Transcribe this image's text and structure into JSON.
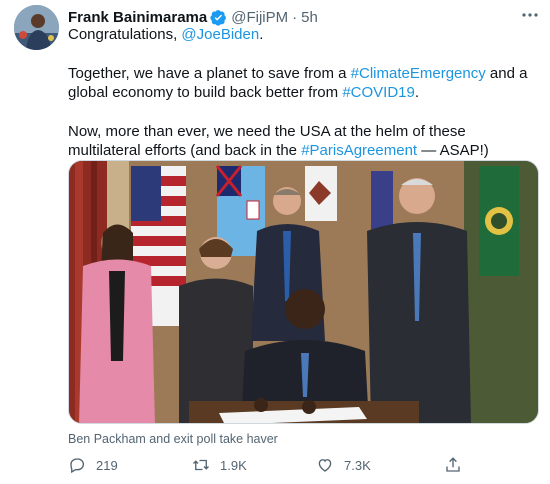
{
  "tweet": {
    "author": {
      "name": "Frank Bainimarama",
      "handle": "@FijiPM",
      "time": "5h"
    },
    "line1_prefix": "Congratulations, ",
    "line1_mention": "@JoeBiden",
    "line1_suffix": ".",
    "p2_a": "Together, we have a planet to save from a ",
    "p2_tag1": "#ClimateEmergency",
    "p2_b": " and a global economy to build back better from ",
    "p2_tag2": "#COVID19",
    "p2_c": ".",
    "p3_a": "Now, more than ever, we need the USA at the helm of these multilateral efforts (and back in the ",
    "p3_tag": "#ParisAgreement",
    "p3_b": " — ASAP!)",
    "caption": "Ben Packham and exit poll take haver",
    "stats": {
      "replies": "219",
      "retweets": "1.9K",
      "likes": "7.3K"
    }
  },
  "icons": [
    "verified-badge-icon",
    "more-icon",
    "reply-icon",
    "retweet-icon",
    "like-icon",
    "share-icon"
  ],
  "colors": {
    "link": "#1b95e0",
    "verified": "#1d9bf0",
    "muted": "#536471"
  }
}
